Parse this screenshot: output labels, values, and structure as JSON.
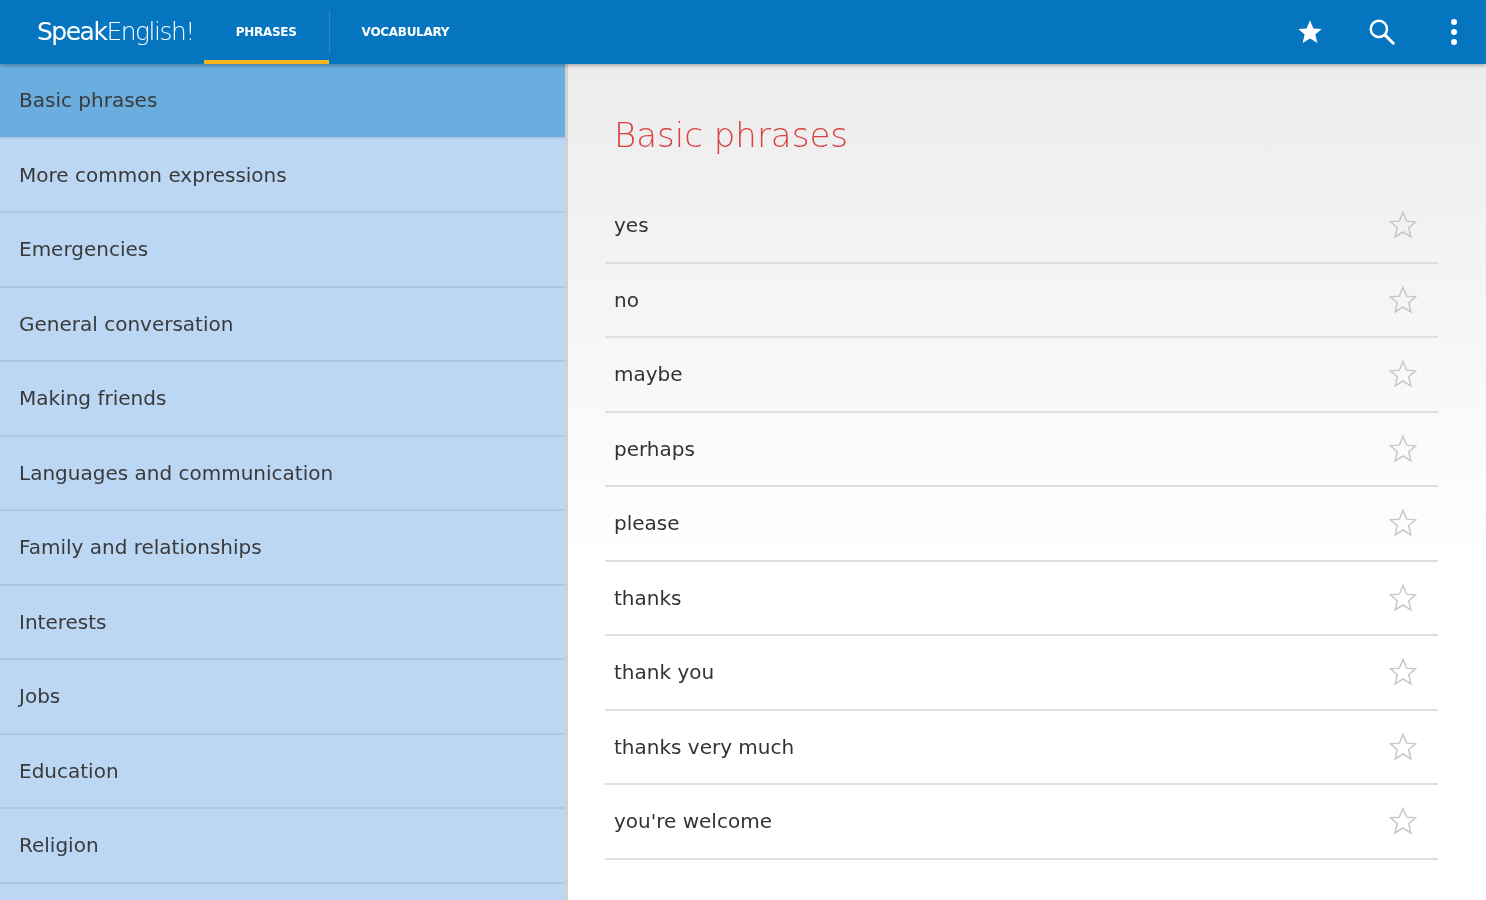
{
  "app_bar": {
    "logo": "**Speak**English!",
    "tabs": [
      {
        "label": "PHRASES",
        "selected": true
      },
      {
        "label": "VOCABULARY",
        "selected": false
      }
    ]
  },
  "sidebar": {
    "items": [
      {
        "label": "Basic phrases",
        "selected": true
      },
      {
        "label": "More common expressions",
        "selected": false
      },
      {
        "label": "Emergencies",
        "selected": false
      },
      {
        "label": "General conversation",
        "selected": false
      },
      {
        "label": "Making friends",
        "selected": false
      },
      {
        "label": "Languages and communication",
        "selected": false
      },
      {
        "label": "Family and relationships",
        "selected": false
      },
      {
        "label": "Interests",
        "selected": false
      },
      {
        "label": "Jobs",
        "selected": false
      },
      {
        "label": "Education",
        "selected": false
      },
      {
        "label": "Religion",
        "selected": false
      }
    ]
  },
  "content": {
    "title": "Basic phrases",
    "phrases": [
      {
        "text": "yes",
        "starred": false
      },
      {
        "text": "no",
        "starred": false
      },
      {
        "text": "maybe",
        "starred": false
      },
      {
        "text": "perhaps",
        "starred": false
      },
      {
        "text": "please",
        "starred": false
      },
      {
        "text": "thanks",
        "starred": false
      },
      {
        "text": "thank you",
        "starred": false
      },
      {
        "text": "thanks very much",
        "starred": false
      },
      {
        "text": "you're welcome",
        "starred": false
      }
    ]
  }
}
